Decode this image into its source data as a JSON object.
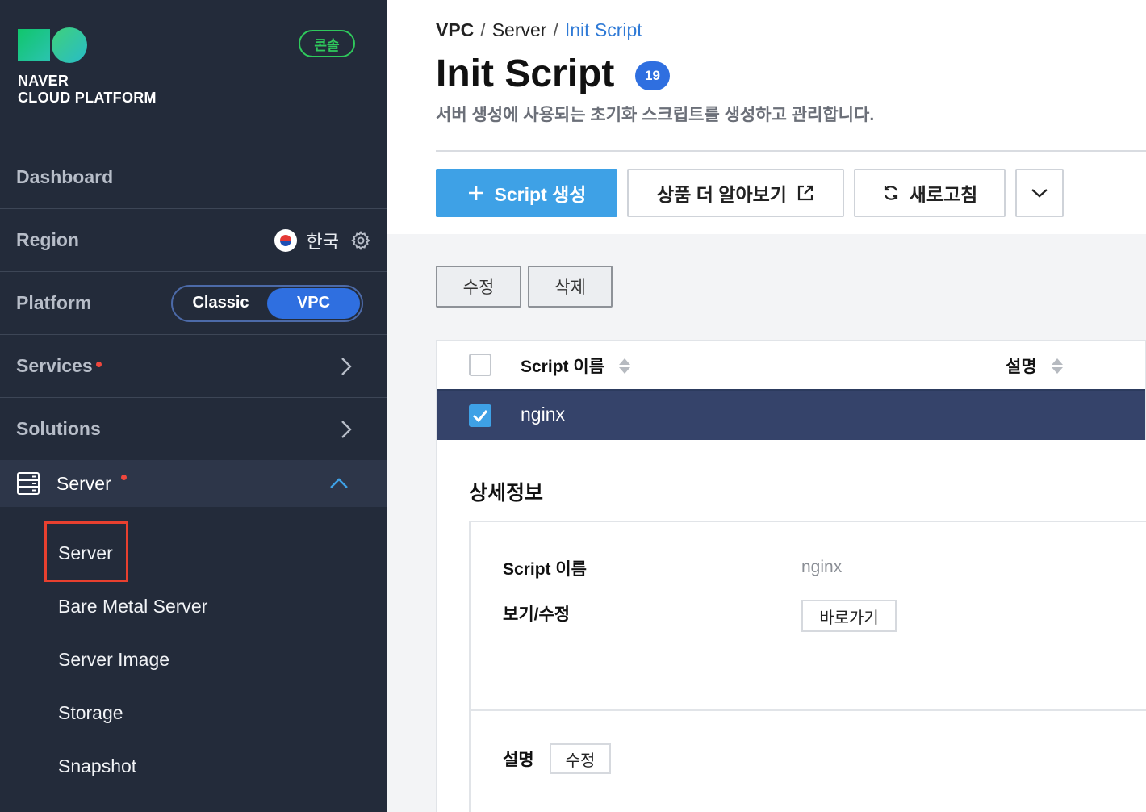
{
  "sidebar": {
    "logo_line1": "NAVER",
    "logo_line2": "CLOUD PLATFORM",
    "console_badge": "콘솔",
    "dashboard": "Dashboard",
    "region_label": "Region",
    "region_value": "한국",
    "platform_label": "Platform",
    "platform_options": [
      "Classic",
      "VPC"
    ],
    "platform_selected": "VPC",
    "services": "Services",
    "solutions": "Solutions",
    "server_group": "Server",
    "server_items": [
      "Server",
      "Bare Metal Server",
      "Server Image",
      "Storage",
      "Snapshot"
    ],
    "active_item": "Server"
  },
  "breadcrumb": [
    "VPC",
    "Server",
    "Init Script"
  ],
  "page": {
    "title": "Init Script",
    "count": "19",
    "description": "서버 생성에 사용되는 초기화 스크립트를 생성하고 관리합니다."
  },
  "toolbar": {
    "create": "Script 생성",
    "learn_more": "상품 더 알아보기",
    "refresh": "새로고침"
  },
  "actions": {
    "edit": "수정",
    "delete": "삭제"
  },
  "table": {
    "columns": [
      "Script 이름",
      "설명"
    ],
    "rows": [
      {
        "name": "nginx",
        "selected": true
      }
    ]
  },
  "detail": {
    "title": "상세정보",
    "name_label": "Script 이름",
    "name_value": "nginx",
    "view_edit_label": "보기/수정",
    "view_edit_button": "바로가기",
    "desc_label": "설명",
    "desc_edit_button": "수정"
  },
  "colors": {
    "sidebar_bg": "#232b3a",
    "accent_blue": "#2f6fe0",
    "primary_button": "#3ea1e6",
    "selected_row": "#35436a",
    "highlight_box": "#e8402f",
    "console_green": "#2fc95c"
  }
}
